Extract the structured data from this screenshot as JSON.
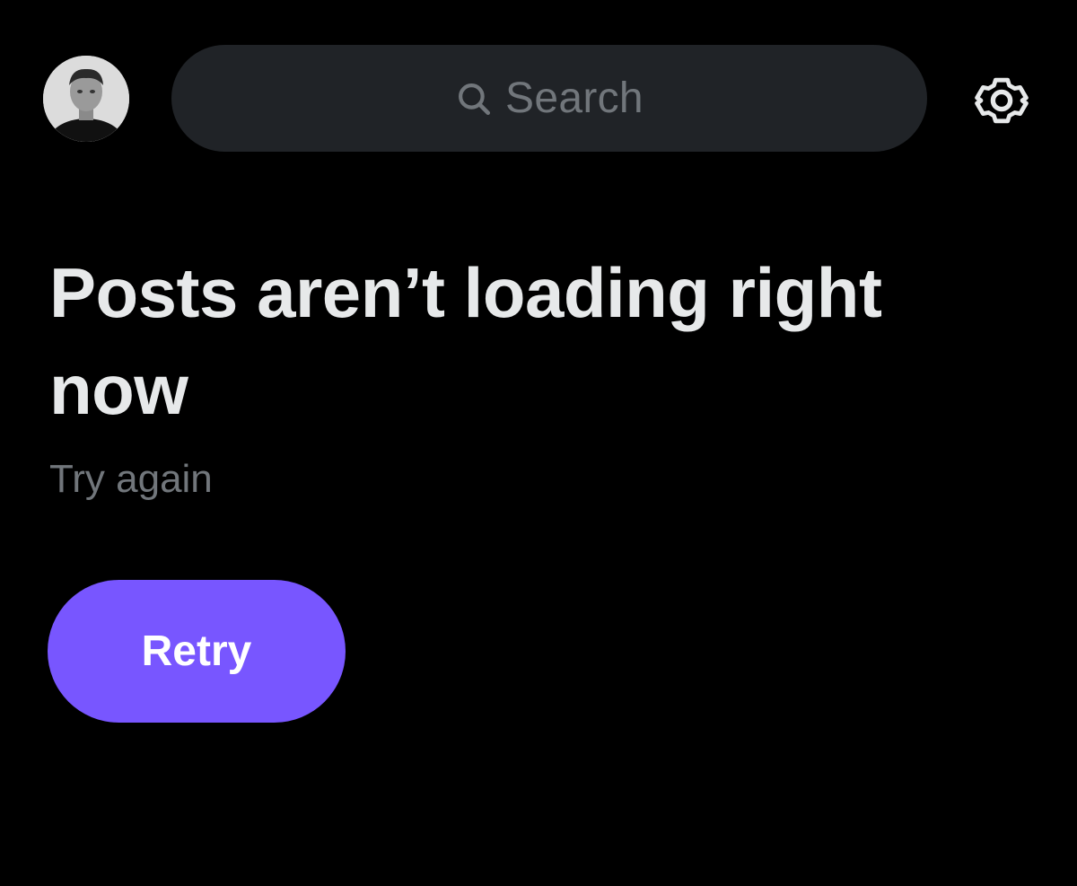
{
  "header": {
    "search": {
      "placeholder": "Search",
      "icon": "search-icon"
    },
    "avatar": {
      "icon": "profile-avatar"
    },
    "settings": {
      "icon": "gear-icon"
    }
  },
  "error": {
    "title": "Posts aren’t loading right now",
    "subtitle": "Try again",
    "retry_label": "Retry"
  },
  "colors": {
    "background": "#000000",
    "search_bg": "#202327",
    "muted_text": "#71767b",
    "primary_text": "#e7e9ea",
    "accent": "#7856ff"
  }
}
